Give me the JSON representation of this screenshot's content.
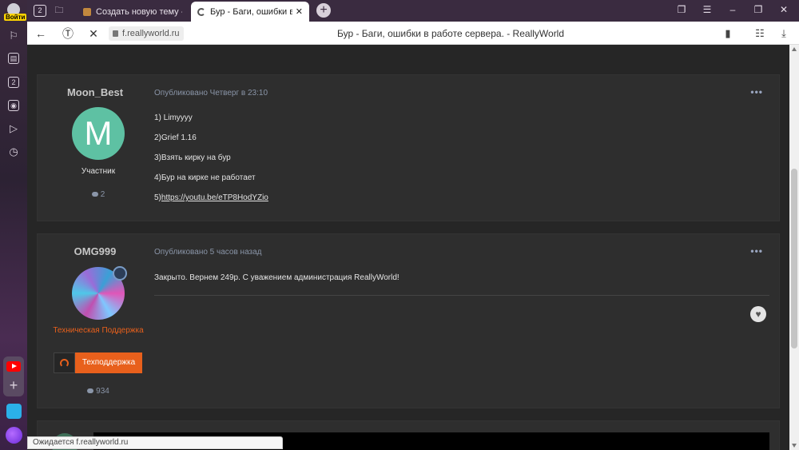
{
  "browser": {
    "login_label": "Войти",
    "tab_counter": "2",
    "sidebar_counter": "2",
    "tabs": [
      {
        "title": "Создать новую тему - Rea"
      },
      {
        "title": "Бур - Баги, ошибки в р"
      }
    ],
    "url": "f.reallyworld.ru",
    "page_title": "Бур - Баги, ошибки в работе сервера. - ReallyWorld",
    "status_text": "Ожидается f.reallyworld.ru"
  },
  "posts": [
    {
      "author": "Moon_Best",
      "avatar_letter": "M",
      "avatar_color": "#5ec1a3",
      "role": "Участник",
      "post_count": "2",
      "date": "Опубликовано Четверг в 23:10",
      "menu": "•••",
      "lines": [
        "1) Limyyyy",
        "2)Grief 1.16",
        "3)Взять кирку на бур",
        "4)Бур на кирке не работает"
      ],
      "link_prefix": "5)",
      "link_text": "https://youtu.be/eTP8HodYZio"
    },
    {
      "author": "OMG999",
      "role": "Техническая Поддержка",
      "role_color": "#e8601c",
      "badge_label": "Техподдержка",
      "post_count": "934",
      "date": "Опубликовано 5 часов назад",
      "menu": "•••",
      "body": "Закрыто. Вернем 249р. С уважением администрация ReallyWorld!"
    }
  ]
}
